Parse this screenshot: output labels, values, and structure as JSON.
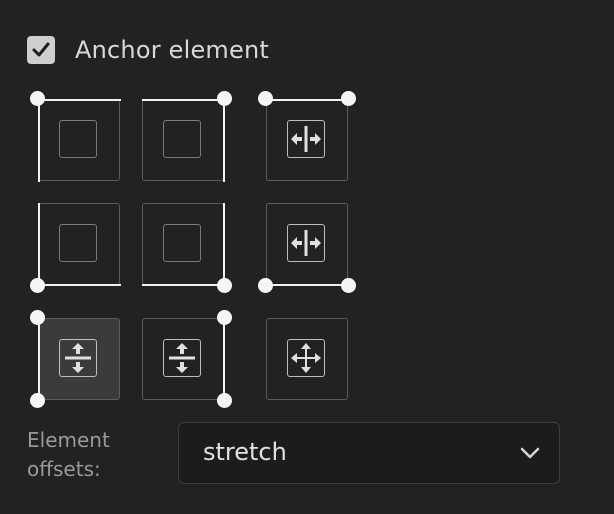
{
  "anchor": {
    "checkbox_label": "Anchor element",
    "checked": true
  },
  "anchor_grid": {
    "selected": "stretch-vertical-left",
    "buttons": [
      {
        "id": "top-left",
        "edges": [
          "top",
          "left"
        ],
        "icon": "square-icon"
      },
      {
        "id": "top-right",
        "edges": [
          "top",
          "right"
        ],
        "icon": "square-icon"
      },
      {
        "id": "top-stretch-horizontal",
        "edges": [
          "top"
        ],
        "icon": "horizontal-stretch-icon"
      },
      {
        "id": "bottom-left",
        "edges": [
          "bottom",
          "left"
        ],
        "icon": "square-icon"
      },
      {
        "id": "bottom-right",
        "edges": [
          "bottom",
          "right"
        ],
        "icon": "square-icon"
      },
      {
        "id": "bottom-stretch-horizontal",
        "edges": [
          "bottom"
        ],
        "icon": "horizontal-stretch-icon"
      },
      {
        "id": "stretch-vertical-left",
        "edges": [
          "left"
        ],
        "icon": "vertical-stretch-icon"
      },
      {
        "id": "stretch-vertical-right",
        "edges": [
          "right"
        ],
        "icon": "vertical-stretch-icon"
      },
      {
        "id": "stretch-both",
        "edges": [],
        "icon": "four-way-stretch-icon"
      }
    ]
  },
  "offsets": {
    "label_line1": "Element",
    "label_line2": "offsets:",
    "selected_value": "stretch"
  },
  "colors": {
    "background": "#222222",
    "edge_highlight": "#f2f2f2",
    "selected_button_bg": "#3b3b3b"
  }
}
